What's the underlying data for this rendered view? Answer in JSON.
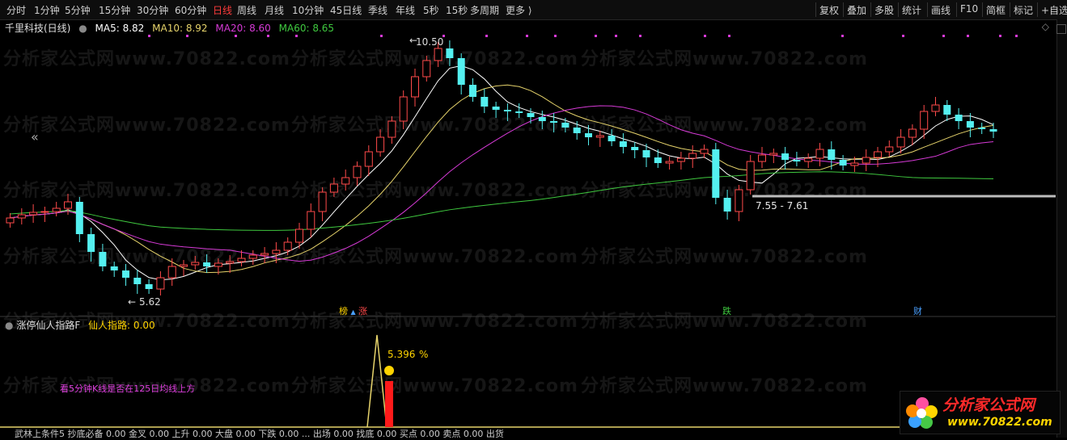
{
  "toolbar": {
    "periods": [
      "分时",
      "1分钟",
      "5分钟",
      "15分钟",
      "30分钟",
      "60分钟",
      "日线",
      "周线",
      "月线",
      "10分钟",
      "45日线",
      "季线",
      "年线",
      "5秒",
      "15秒",
      "多周期",
      "更多 ⟩"
    ],
    "active_index": 6,
    "right_items": [
      "复权",
      "叠加",
      "多股",
      "统计",
      "画线",
      "F10",
      "简框",
      "标记",
      "+自选"
    ]
  },
  "stock": {
    "title": "千里科技(日线)",
    "ma": [
      {
        "label": "MA5: 8.82",
        "color": "#ffffff"
      },
      {
        "label": "MA10: 8.92",
        "color": "#e6d36b"
      },
      {
        "label": "MA20: 8.60",
        "color": "#d63ad6"
      },
      {
        "label": "MA60: 8.65",
        "color": "#3fc93f"
      }
    ]
  },
  "colors": {
    "up": "#ff4a4a",
    "down": "#54f0f0",
    "ma5": "#ffffff",
    "ma10": "#e6d36b",
    "ma20": "#d63ad6",
    "ma60": "#3fc93f"
  },
  "annotations": {
    "high": "10.50",
    "low": "5.62",
    "range": "7.55 - 7.61"
  },
  "markers": [
    {
      "text": "榜",
      "color": "#ffd400",
      "bg": "#3a2a00"
    },
    {
      "text": "涨",
      "color": "#ff4a4a",
      "bg": "#2a0000"
    },
    {
      "text": "跌",
      "color": "#3fc93f",
      "bg": "#002a00"
    },
    {
      "text": "财",
      "color": "#4aa0ff",
      "bg": "#00162a"
    }
  ],
  "watermark": "分析家公式网www.70822.com",
  "indicator": {
    "name": "涨停仙人指路F",
    "value_label": "仙人指路: 0.00",
    "pct": "5.396",
    "pct_unit": "%",
    "note": "看5分钟K线是否在125日均线上方",
    "peak_value_pct": 5.396
  },
  "logo": {
    "text": "分析家公式网",
    "url": "www.70822.com"
  },
  "bottom_text": "武林上条件5 抄底必备  0.00   金叉  0.00   上升  0.00   大盘  0.00   下跌   0.00   ...   出场  0.00   找底  0.00   买点  0.00   卖点  0.00   出货"
}
